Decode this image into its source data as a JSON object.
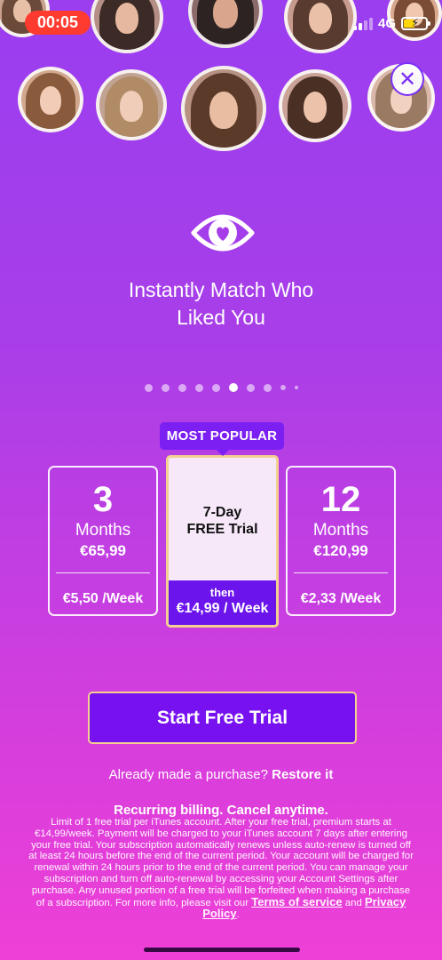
{
  "status_bar": {
    "time": "00:05",
    "network": "4G",
    "colors": {
      "time_pill": "#ff3b30",
      "battery": "#ffd60a"
    }
  },
  "avatars": [
    {
      "name": "avatar-1",
      "hair": "#6b4a3a",
      "skin": "#e8c0a8",
      "bg": "#c9a08d"
    },
    {
      "name": "avatar-2",
      "hair": "#3b2a25",
      "skin": "#e6b8a0",
      "bg": "#b58f86"
    },
    {
      "name": "avatar-3",
      "hair": "#2d2322",
      "skin": "#d9a58c",
      "bg": "#8b6a6a"
    },
    {
      "name": "avatar-4",
      "hair": "#5a3b2f",
      "skin": "#ebc0a8",
      "bg": "#c79b8e"
    },
    {
      "name": "avatar-5",
      "hair": "#7b4c35",
      "skin": "#f0c8b0",
      "bg": "#d8a88f"
    },
    {
      "name": "avatar-6",
      "hair": "#8a5a3c",
      "skin": "#f2ccb6",
      "bg": "#d2a98e"
    },
    {
      "name": "avatar-7",
      "hair": "#b08b65",
      "skin": "#efcdb8",
      "bg": "#c1a394"
    },
    {
      "name": "avatar-8",
      "hair": "#5b3a2a",
      "skin": "#e9bda2",
      "bg": "#b79282"
    },
    {
      "name": "avatar-9",
      "hair": "#4a2f25",
      "skin": "#ecc2aa",
      "bg": "#caa297"
    },
    {
      "name": "avatar-10",
      "hair": "#9a7a63",
      "skin": "#f1d1bf",
      "bg": "#d9b8aa"
    }
  ],
  "close_icon": "close-icon",
  "feature": {
    "icon": "eye-heart-icon",
    "headline": "Instantly Match Who\nLiked You"
  },
  "pager": {
    "count": 10,
    "active_index": 5
  },
  "plans": {
    "popular_badge": "MOST POPULAR",
    "left": {
      "number": "3",
      "unit": "Months",
      "price": "€65,99",
      "weekly": "€5,50 /Week"
    },
    "center": {
      "title": "7-Day\nFREE Trial",
      "then_label": "then",
      "then_price": "€14,99 / Week"
    },
    "right": {
      "number": "12",
      "unit": "Months",
      "price": "€120,99",
      "weekly": "€2,33 /Week"
    }
  },
  "cta": {
    "label": "Start Free Trial"
  },
  "restore": {
    "prefix": "Already made a purchase?",
    "link": "Restore it"
  },
  "billing": {
    "title": "Recurring billing. Cancel anytime.",
    "legal_text": "Limit of 1 free trial per iTunes account. After your free trial, premium starts at €14,99/week. Payment will be charged to your iTunes account 7 days after entering your free trial. Your subscription automatically renews unless auto-renew is turned off at least 24 hours before the end of the current period. Your account will be charged for renewal within 24 hours prior to the end of the current period. You can manage your subscription and turn off auto-renewal by accessing your Account Settings after purchase. Any unused portion of a free trial will be forfeited when making a purchase of a subscription. For more info, please visit our",
    "terms_link": "Terms of service",
    "and_text": "and",
    "privacy_link": "Privacy Policy",
    "period": "."
  },
  "theme": {
    "gradient_top": "#9a3ef0",
    "gradient_bottom": "#ef3fd6",
    "accent": "#7811f0",
    "gold_border": "#f3d090"
  }
}
